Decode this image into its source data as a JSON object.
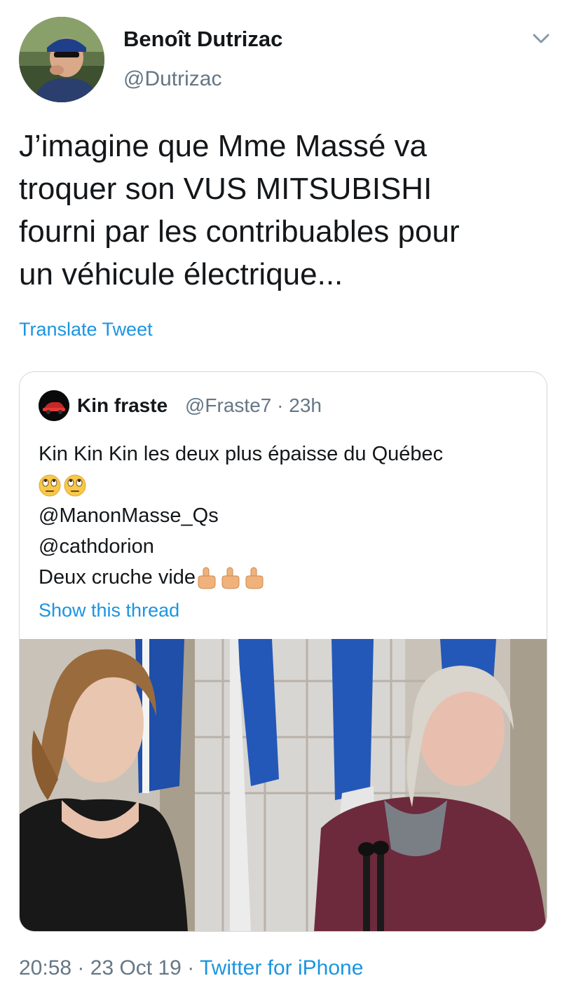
{
  "author": {
    "name": "Benoît Dutrizac",
    "handle": "@Dutrizac"
  },
  "tweet": {
    "text_lines": [
      "J’imagine que Mme Massé va",
      "troquer son VUS MITSUBISHI",
      "fourni par les contribuables pour",
      "un véhicule électrique..."
    ],
    "translate_label": "Translate Tweet"
  },
  "quoted": {
    "name": "Kin fraste",
    "handle": "@Fraste7",
    "separator": "·",
    "time": "23h",
    "lines": {
      "line1": "Kin Kin Kin les deux plus épaisse du Québec",
      "line2": "🙄🙄",
      "line3": "@ManonMasse_Qs",
      "line4": "@cathdorion",
      "line5": "Deux cruche vide"
    },
    "emoji_line2": "face-with-rolling-eyes x2",
    "emoji_line5": "middle-finger x3",
    "show_thread": "Show this thread"
  },
  "footer": {
    "time": "20:58",
    "dot1": "·",
    "date": "23 Oct 19",
    "dot2": "·",
    "source": "Twitter for iPhone"
  },
  "colors": {
    "link": "#1b95e0",
    "secondary": "#657786",
    "text": "#14171a",
    "border": "#cfd9de"
  }
}
